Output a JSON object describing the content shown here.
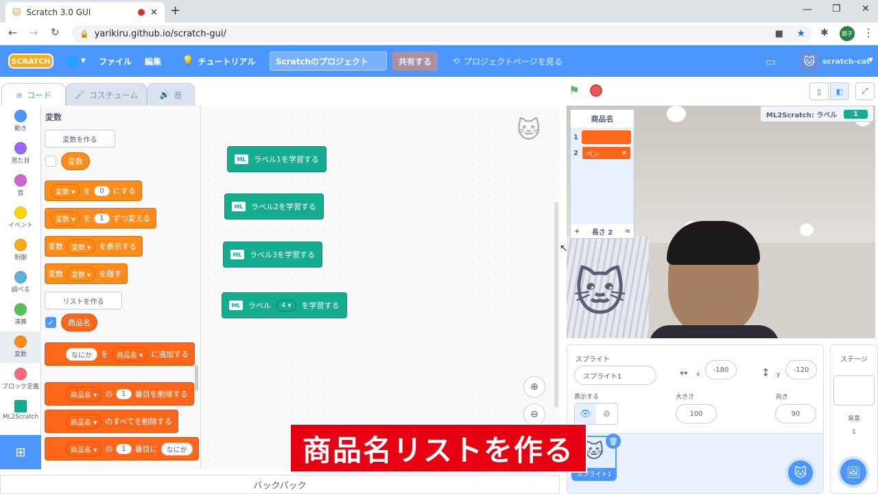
{
  "browser": {
    "tab_title": "Scratch 3.0 GUI",
    "url": "yarikiru.github.io/scratch-gui/",
    "profile": "題子"
  },
  "menu": {
    "logo": "SCRATCH",
    "file": "ファイル",
    "edit": "編集",
    "tutorial": "チュートリアル",
    "project_title": "Scratchのプロジェクト",
    "share": "共有する",
    "see_project_page": "プロジェクトページを見る",
    "username": "scratch-cat"
  },
  "tabs": {
    "code": "コード",
    "costume": "コスチューム",
    "sound": "音"
  },
  "categories": [
    {
      "label": "動き",
      "color": "#4c97ff"
    },
    {
      "label": "見た目",
      "color": "#9966ff"
    },
    {
      "label": "音",
      "color": "#cf63cf"
    },
    {
      "label": "イベント",
      "color": "#ffd500"
    },
    {
      "label": "制御",
      "color": "#ffab19"
    },
    {
      "label": "調べる",
      "color": "#5cb1d6"
    },
    {
      "label": "演算",
      "color": "#59c059"
    },
    {
      "label": "変数",
      "color": "#ff8c1a"
    },
    {
      "label": "ブロック定義",
      "color": "#ff6680"
    },
    {
      "label": "ML2Scratch",
      "color": "#14ad8f"
    }
  ],
  "palette": {
    "heading": "変数",
    "make_variable": "変数を作る",
    "variable_name": "変数",
    "set_block": {
      "var": "変数",
      "to": "を",
      "value": "0",
      "suffix": "にする"
    },
    "change_block": {
      "var": "変数",
      "by": "を",
      "value": "1",
      "suffix": "ずつ変える"
    },
    "show_block": {
      "prefix": "変数",
      "var": "変数",
      "suffix": "を表示する"
    },
    "hide_block": {
      "prefix": "変数",
      "var": "変数",
      "suffix": "を隠す"
    },
    "make_list": "リストを作る",
    "list_name": "商品名",
    "add_block": {
      "item": "なにか",
      "to": "を",
      "list": "商品名",
      "suffix": "に追加する"
    },
    "delete_block": {
      "list": "商品名",
      "of": "の",
      "value": "1",
      "suffix": "番目を削除する"
    },
    "delete_all_block": {
      "list": "商品名",
      "suffix": "のすべてを削除する"
    },
    "insert_block": {
      "list": "商品名",
      "of": "の",
      "value": "1",
      "mid": "番目に",
      "item": "なにか"
    }
  },
  "workspace": {
    "blocks": [
      "ラベル1を学習する",
      "ラベル2を学習する",
      "ラベル3を学習する"
    ],
    "block4": {
      "prefix": "ラベル",
      "value": "4",
      "suffix": "を学習する"
    },
    "ml_icon": "ML"
  },
  "backpack": "バックパック",
  "stage": {
    "list_monitor": {
      "title": "商品名",
      "items": [
        "",
        "ペン"
      ],
      "indexes": [
        "1",
        "2"
      ],
      "add": "+",
      "length": "長さ 2",
      "resize": "="
    },
    "label_monitor": {
      "name": "ML2Scratch: ラベル",
      "value": "1"
    }
  },
  "sprite_info": {
    "sprite_label": "スプライト",
    "sprite_name": "スプライト1",
    "x_label": "x",
    "x": "-180",
    "y_label": "y",
    "y": "-120",
    "show_label": "表示する",
    "size_label": "大きさ",
    "size": "100",
    "direction_label": "向き",
    "direction": "90",
    "thumb_name": "スプライト1"
  },
  "stage_panel": {
    "title": "ステージ",
    "backdrops_label": "背景",
    "backdrops_count": "1"
  },
  "caption": "商品名リストを作る",
  "colors": {
    "scratch_blue": "#4c97ff",
    "variables": "#ff8c1a",
    "ml": "#14ad8f",
    "caption_red": "#e60012"
  }
}
